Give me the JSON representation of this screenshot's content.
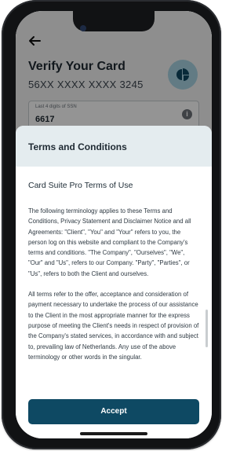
{
  "header": {
    "title": "Verify Your Card",
    "card_number": "56XX XXXX XXXX 3245"
  },
  "ssn_field": {
    "label": "Last 4 digits of SSN",
    "value": "6617",
    "info_icon": "info-icon"
  },
  "terms": {
    "sheet_title": "Terms and Conditions",
    "heading": "Card Suite Pro Terms of Use",
    "paragraphs": [
      "The following terminology applies to these Terms and Conditions, Privacy Statement and Disclaimer Notice and all Agreements: \"Client\", \"You\" and \"Your\" refers to you, the person log on this website and compliant to the Company's terms and conditions. \"The Company\", \"Ourselves\", \"We\", \"Our\" and \"Us\", refers to our Company. \"Party\", \"Parties\", or \"Us\", refers to both the Client and ourselves.",
      "All terms refer to the offer, acceptance and consideration of payment necessary to undertake the process of our assistance to the Client in the most appropriate manner for the express purpose of meeting the Client's needs in respect of provision of the Company's stated services, in accordance with and subject to, prevailing law of Netherlands. Any use of the above terminology or other words in the singular."
    ],
    "accept_label": "Accept"
  },
  "colors": {
    "accent": "#0e4963",
    "sheet_header": "#e4ecef",
    "avatar": "#a9d4e4"
  },
  "icons": [
    "back-arrow-icon",
    "card-logo-icon",
    "info-icon"
  ]
}
